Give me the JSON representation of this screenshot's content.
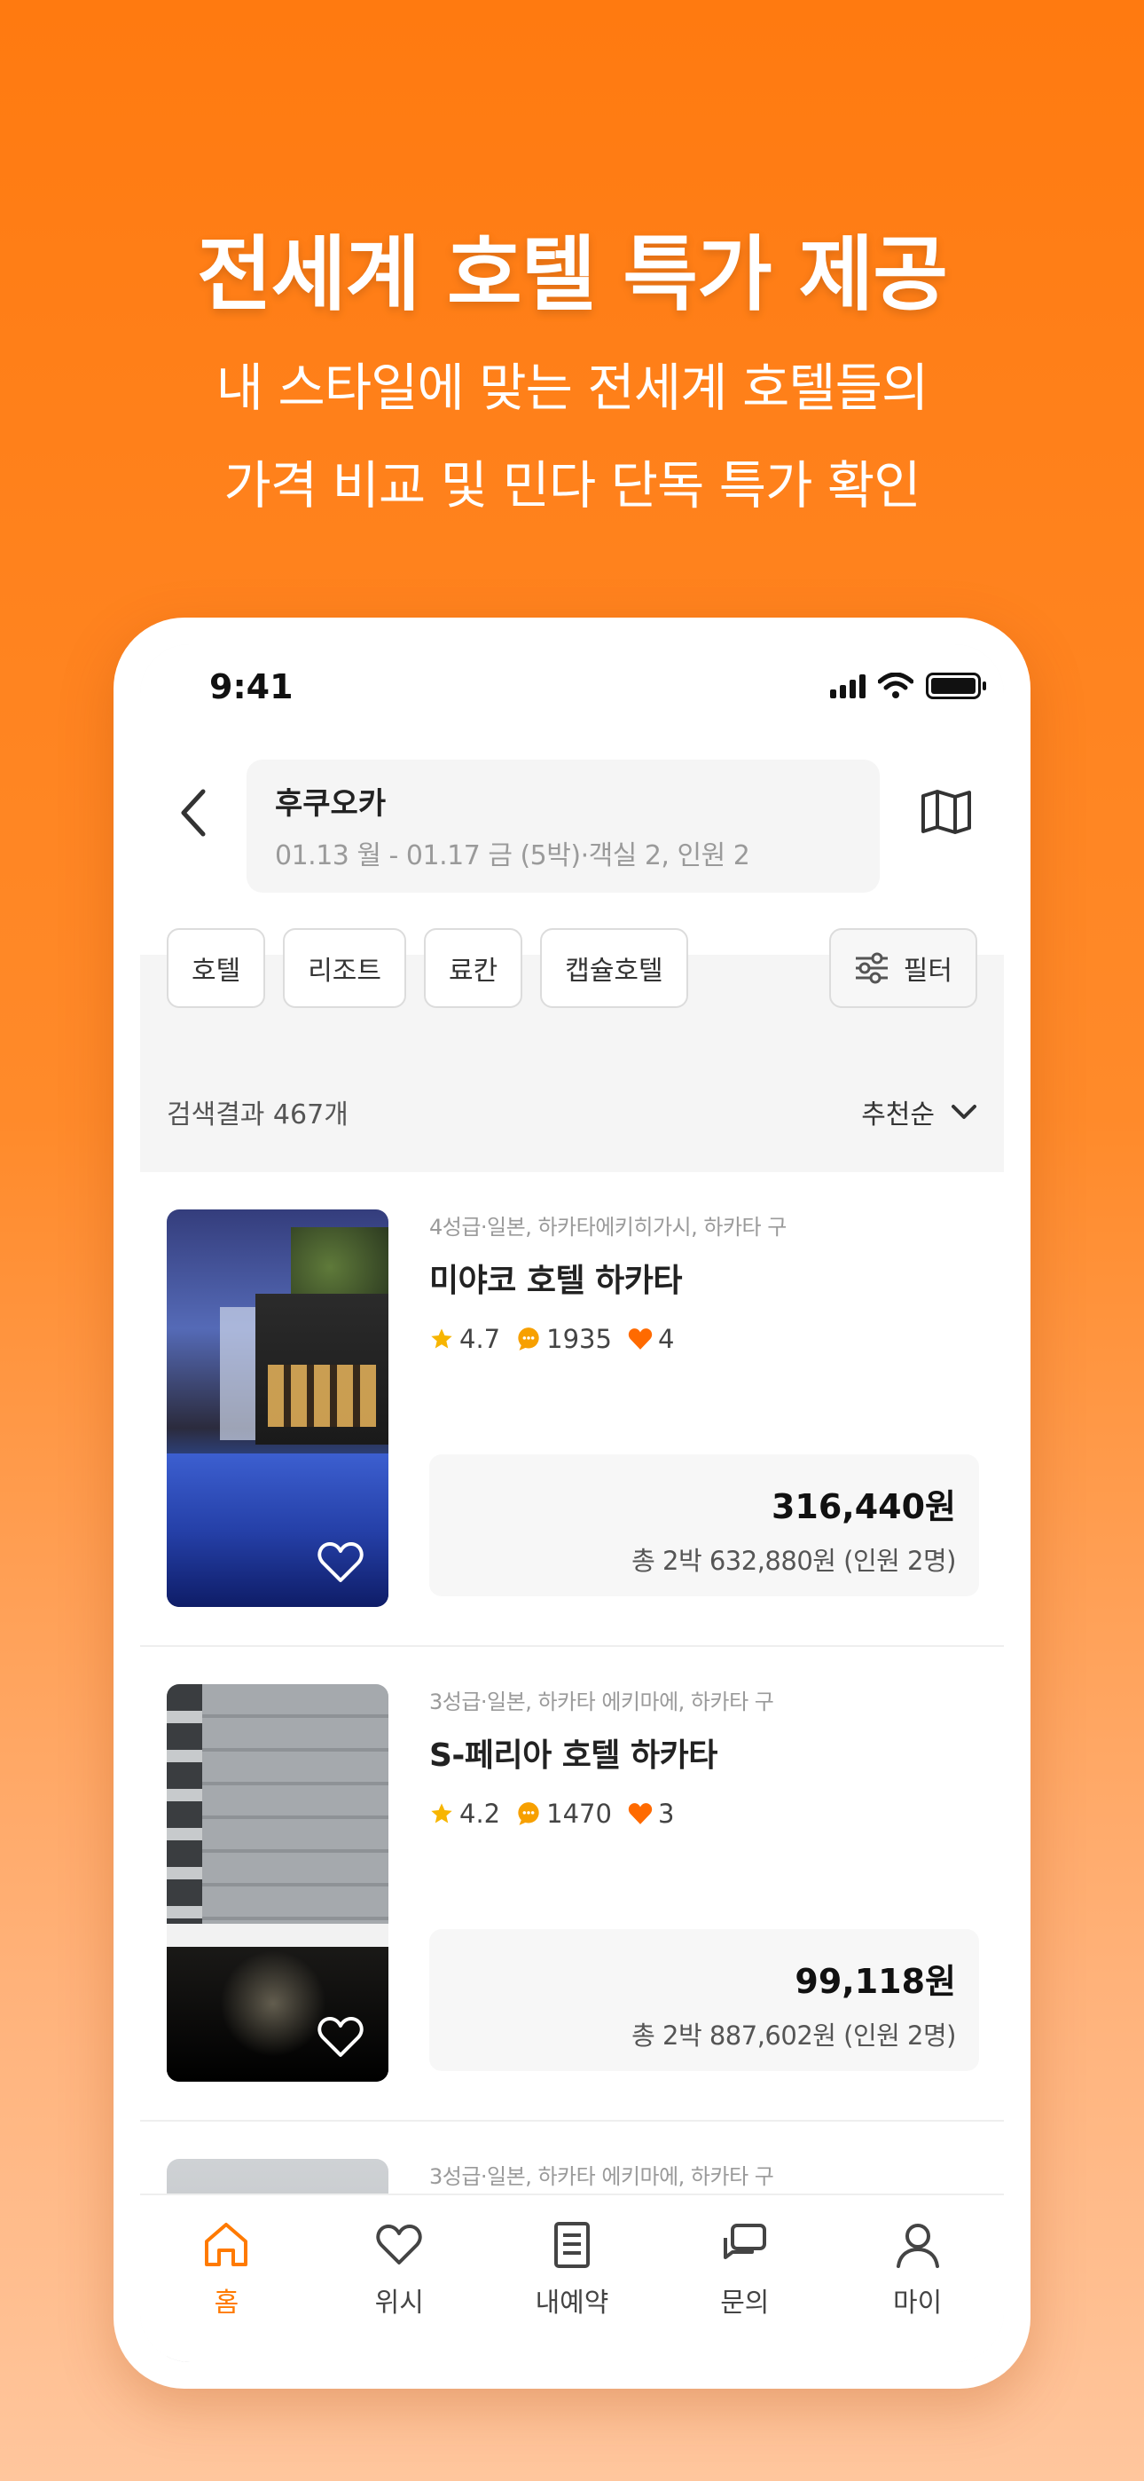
{
  "hero": {
    "title": "전세계 호텔 특가 제공",
    "subtitle_line1": "내 스타일에 맞는 전세계 호텔들의",
    "subtitle_line2": "가격 비교 및 민다 단독 특가 확인"
  },
  "status_bar": {
    "time": "9:41",
    "icons": [
      "signal-icon",
      "wifi-icon",
      "battery-icon"
    ]
  },
  "search": {
    "city": "후쿠오카",
    "meta": "01.13 월 - 01.17 금 (5박)·객실 2, 인원 2",
    "back_icon": "chevron-left-icon",
    "map_icon": "map-icon"
  },
  "categories": [
    "호텔",
    "리조트",
    "료칸",
    "캡슐호텔"
  ],
  "filter": {
    "label": "필터",
    "icon": "sliders-icon"
  },
  "results": {
    "count_label": "검색결과 467개",
    "sort_label": "추천순"
  },
  "hotels": [
    {
      "location": "4성급·일본, 하카타에키히가시, 하카타 구",
      "name": "미야코 호텔 하카타",
      "rating": "4.7",
      "reviews": "1935",
      "likes": "4",
      "price": "316,440원",
      "total": "총 2박 632,880원 (인원 2명)"
    },
    {
      "location": "3성급·일본, 하카타 에키마에, 하카타 구",
      "name": "S-페리아 호텔 하카타",
      "rating": "4.2",
      "reviews": "1470",
      "likes": "3",
      "price": "99,118원",
      "total": "총 2박 887,602원 (인원 2명)"
    },
    {
      "location": "3성급·일본, 하카타 에키마에, 하카타 구"
    }
  ],
  "tabs": [
    {
      "label": "홈",
      "icon": "home-icon",
      "active": true
    },
    {
      "label": "위시",
      "icon": "heart-icon",
      "active": false
    },
    {
      "label": "내예약",
      "icon": "document-icon",
      "active": false
    },
    {
      "label": "문의",
      "icon": "chat-icon",
      "active": false
    },
    {
      "label": "마이",
      "icon": "user-icon",
      "active": false
    }
  ],
  "colors": {
    "accent": "#ff7a00",
    "star": "#f7b500",
    "bubble": "#f7a000",
    "heart": "#ff6a00"
  }
}
